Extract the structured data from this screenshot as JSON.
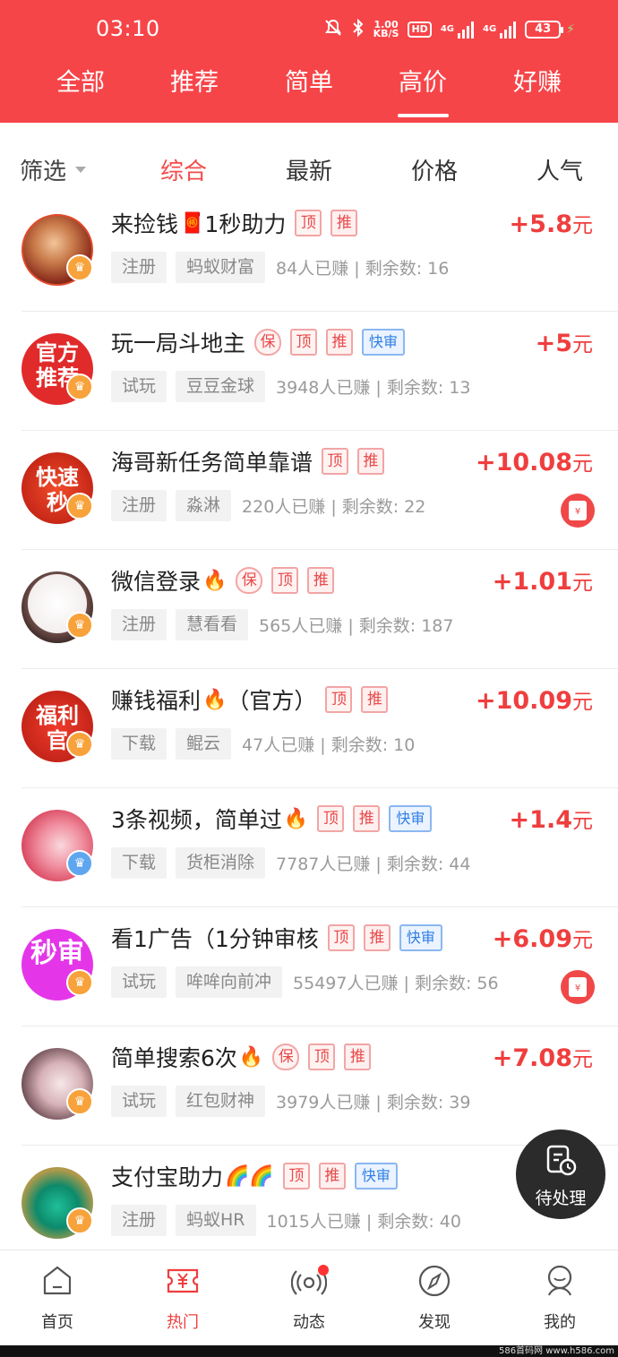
{
  "status": {
    "time": "03:10",
    "speed_top": "1.00",
    "speed_bottom": "KB/S",
    "hd": "HD",
    "net1": "4G",
    "net2": "4G",
    "battery": "43"
  },
  "categories": [
    "全部",
    "推荐",
    "简单",
    "高价",
    "好赚"
  ],
  "active_category": "高价",
  "sort": {
    "filter": "筛选",
    "options": [
      "综合",
      "最新",
      "价格",
      "人气"
    ],
    "active": "综合"
  },
  "tasks": [
    {
      "title": "来捡钱",
      "title2": "1秒助力",
      "emoji": "🧧",
      "tags": [
        "顶",
        "推"
      ],
      "type": "注册",
      "publisher": "蚂蚁财富",
      "stats": "84人已赚 | 剩余数: 16",
      "price": "+5.8",
      "unit": "元",
      "redpack": false,
      "badge": "gold"
    },
    {
      "title": "玩一局斗地主",
      "title2": "",
      "emoji": "",
      "tags": [
        "保",
        "顶",
        "推",
        "快审"
      ],
      "type": "试玩",
      "publisher": "豆豆金球",
      "stats": "3948人已赚 | 剩余数: 13",
      "price": "+5",
      "unit": "元",
      "redpack": false,
      "badge": "gold",
      "avatar_text": "官方推荐"
    },
    {
      "title": "海哥新任务简单靠谱",
      "title2": "",
      "emoji": "",
      "tags": [
        "顶",
        "推"
      ],
      "type": "注册",
      "publisher": "淼淋",
      "stats": "220人已赚 | 剩余数: 22",
      "price": "+10.08",
      "unit": "元",
      "redpack": true,
      "badge": "gold",
      "avatar_text": "快速秒"
    },
    {
      "title": "微信登录",
      "title2": "",
      "emoji": "🔥",
      "tags": [
        "保",
        "顶",
        "推"
      ],
      "type": "注册",
      "publisher": "慧看看",
      "stats": "565人已赚 | 剩余数: 187",
      "price": "+1.01",
      "unit": "元",
      "redpack": false,
      "badge": "gold"
    },
    {
      "title": "赚钱福利",
      "title2": "（官方）",
      "emoji": "🔥",
      "tags": [
        "顶",
        "推"
      ],
      "type": "下载",
      "publisher": "鲲云",
      "stats": "47人已赚 | 剩余数: 10",
      "price": "+10.09",
      "unit": "元",
      "redpack": false,
      "badge": "gold",
      "avatar_text": "福利官"
    },
    {
      "title": "3条视频，简单过",
      "title2": "",
      "emoji": "🔥",
      "tags": [
        "顶",
        "推",
        "快审"
      ],
      "type": "下载",
      "publisher": "货柜消除",
      "stats": "7787人已赚 | 剩余数: 44",
      "price": "+1.4",
      "unit": "元",
      "redpack": false,
      "badge": "blue"
    },
    {
      "title": "看1广告（1分钟审核",
      "title2": "",
      "emoji": "",
      "tags": [
        "顶",
        "推",
        "快审"
      ],
      "type": "试玩",
      "publisher": "哞哞向前冲",
      "stats": "55497人已赚 | 剩余数: 56",
      "price": "+6.09",
      "unit": "元",
      "redpack": true,
      "badge": "gold",
      "avatar_text": "秒审"
    },
    {
      "title": "简单搜索6次",
      "title2": "",
      "emoji": "🔥",
      "tags": [
        "保",
        "顶",
        "推"
      ],
      "type": "试玩",
      "publisher": "红包财神",
      "stats": "3979人已赚 | 剩余数: 39",
      "price": "+7.08",
      "unit": "元",
      "redpack": false,
      "badge": "gold"
    },
    {
      "title": "支付宝助力",
      "title2": "",
      "emoji": "🌈🌈",
      "tags": [
        "顶",
        "推",
        "快审"
      ],
      "type": "注册",
      "publisher": "蚂蚁HR",
      "stats": "1015人已赚 | 剩余数: 40",
      "price": "",
      "unit": "",
      "redpack": false,
      "badge": "gold"
    }
  ],
  "fab": {
    "label": "待处理"
  },
  "nav": [
    {
      "label": "首页",
      "icon": "home-icon"
    },
    {
      "label": "热门",
      "icon": "hot-ticket-icon"
    },
    {
      "label": "动态",
      "icon": "broadcast-icon"
    },
    {
      "label": "发现",
      "icon": "compass-icon"
    },
    {
      "label": "我的",
      "icon": "profile-icon"
    }
  ],
  "active_nav": "热门",
  "watermark": "586首码网 www.h586.com",
  "colors": {
    "brand": "#f64549",
    "price": "#ef3e3e",
    "quick": "#2f7ee5"
  }
}
